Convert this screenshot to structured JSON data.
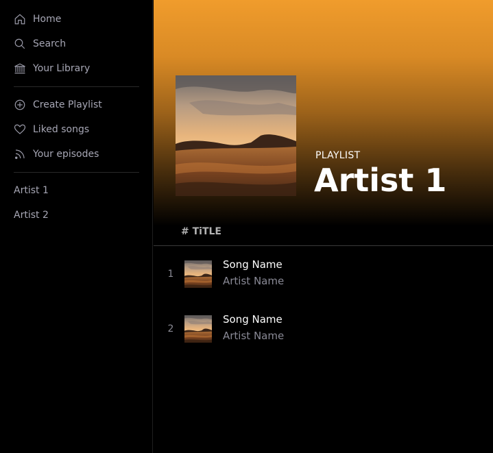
{
  "sidebar": {
    "nav": [
      {
        "label": "Home",
        "icon": "home-icon"
      },
      {
        "label": "Search",
        "icon": "search-icon"
      },
      {
        "label": "Your Library",
        "icon": "library-icon"
      }
    ],
    "actions": [
      {
        "label": "Create Playlist",
        "icon": "plus-circle-icon"
      },
      {
        "label": "Liked songs",
        "icon": "heart-icon"
      },
      {
        "label": "Your episodes",
        "icon": "rss-icon"
      }
    ],
    "playlists": [
      "Artist 1",
      "Artist 2"
    ]
  },
  "header": {
    "type_label": "PLAYLIST",
    "title": "Artist 1",
    "gradient_color": "#f09c2c"
  },
  "table": {
    "column_header": "# TiTLE",
    "tracks": [
      {
        "number": "1",
        "song": "Song Name",
        "artist": "Artist Name"
      },
      {
        "number": "2",
        "song": "Song Name",
        "artist": "Artist Name"
      }
    ]
  }
}
